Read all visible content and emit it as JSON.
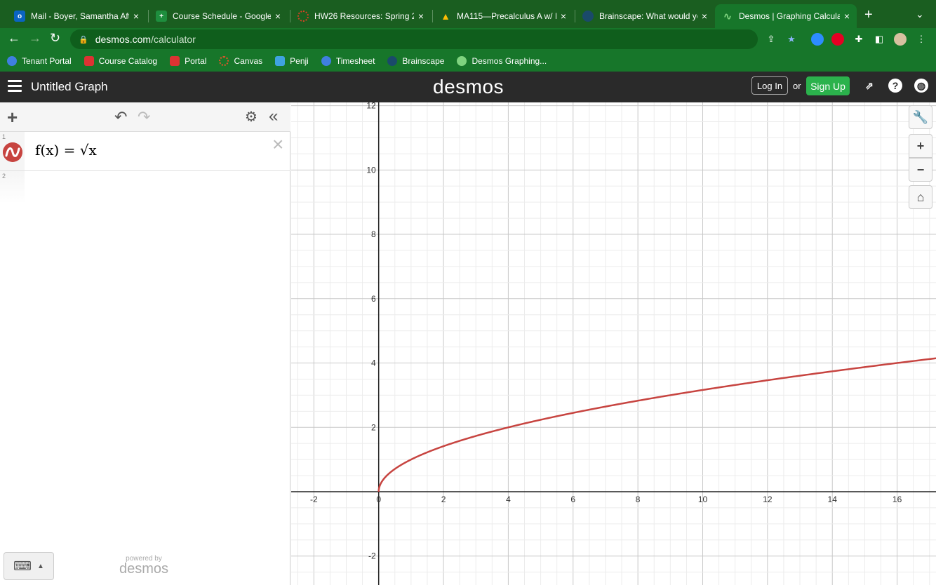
{
  "browser": {
    "tabs": [
      {
        "title": "Mail - Boyer, Samantha Aft",
        "fav": "o",
        "color": "#0a64c2"
      },
      {
        "title": "Course Schedule - Google",
        "fav": "+",
        "color": "#1e8e3e"
      },
      {
        "title": "HW26 Resources: Spring 2",
        "fav": "",
        "color": "#d64224"
      },
      {
        "title": "MA115—Precalculus A w/ Ir",
        "fav": "▲",
        "color": "#fbbc04"
      },
      {
        "title": "Brainscape: What would yo",
        "fav": "",
        "color": "#3a8fd8"
      },
      {
        "title": "Desmos | Graphing Calcula",
        "fav": "∿",
        "color": "#7fd37f"
      }
    ],
    "close_glyph": "×",
    "new_tab": "+",
    "tab_menu": "⌄",
    "url_host": "desmos.com",
    "url_path": "/calculator",
    "bookmarks": [
      {
        "label": "Tenant Portal",
        "color": "#3f7fe0"
      },
      {
        "label": "Course Catalog",
        "color": "#d33"
      },
      {
        "label": "Portal",
        "color": "#d33"
      },
      {
        "label": "Canvas",
        "color": "#e2552b"
      },
      {
        "label": "Penji",
        "color": "#3fa3e0"
      },
      {
        "label": "Timesheet",
        "color": "#3f7fe0"
      },
      {
        "label": "Brainscape",
        "color": "#3a8fd8"
      },
      {
        "label": "Desmos Graphing...",
        "color": "#7fd37f"
      }
    ]
  },
  "desmos": {
    "graph_title": "Untitled Graph",
    "logo": "desmos",
    "login_label": "Log In",
    "or_label": "or",
    "signup_label": "Sign Up",
    "expressions": [
      {
        "number": "1",
        "latex": "f(x) = √x",
        "color": "#c74440"
      },
      {
        "number": "2",
        "latex": ""
      }
    ],
    "powered_by": "powered by",
    "powered_logo": "desmos"
  },
  "chart_data": {
    "type": "line",
    "title": "",
    "xlabel": "",
    "ylabel": "",
    "xlim": [
      -2.7,
      17.2
    ],
    "ylim": [
      -2.9,
      12.1
    ],
    "x_ticks": [
      -2,
      0,
      2,
      4,
      6,
      8,
      10,
      12,
      14,
      16
    ],
    "y_ticks": [
      -2,
      2,
      4,
      6,
      8,
      10,
      12
    ],
    "grid": true,
    "series": [
      {
        "expression": "f(x) = √x",
        "color": "#c74440",
        "domain": [
          0,
          17.2
        ]
      }
    ]
  }
}
